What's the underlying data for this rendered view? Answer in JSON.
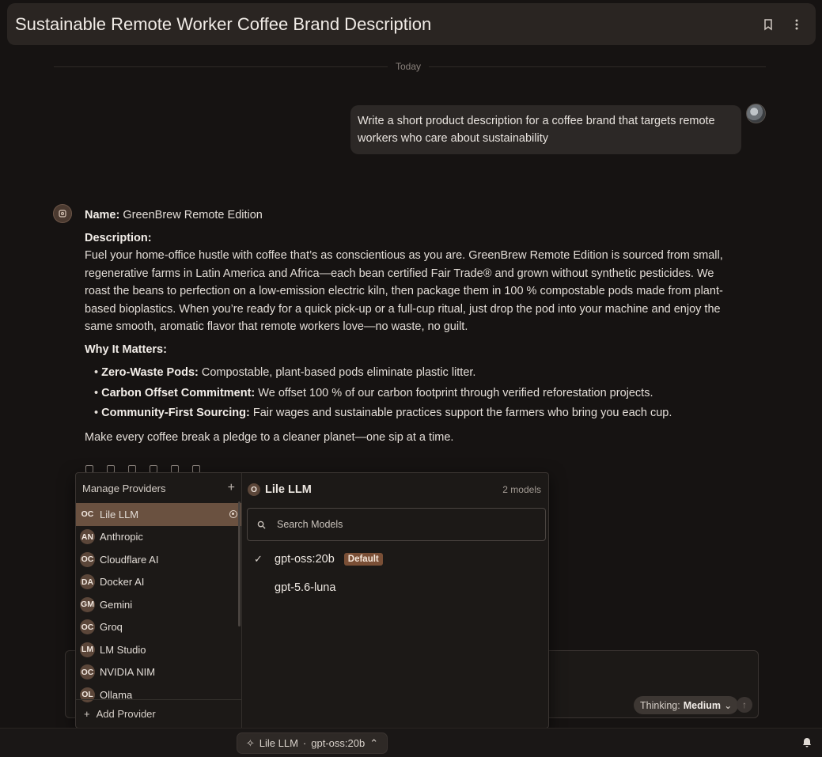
{
  "header": {
    "title": "Sustainable Remote Worker Coffee Brand Description",
    "bookmark_icon": "bookmark-icon",
    "more_icon": "more-vertical-icon"
  },
  "chat": {
    "day_label": "Today",
    "user_message": "Write a short product description for a coffee brand that targets remote workers who care about sustainability",
    "assistant": {
      "name_label": "Name:",
      "name_value": "GreenBrew Remote Edition",
      "description_label": "Description:",
      "description_text": "Fuel your home-office hustle with coffee that’s as conscientious as you are. GreenBrew Remote Edition is sourced from small, regenerative farms in Latin America and Africa—each bean certified Fair Trade® and grown without synthetic pesticides. We roast the beans to perfection on a low-emission electric kiln, then package them in 100 % compostable pods made from plant-based bioplastics. When you’re ready for a quick pick-up or a full-cup ritual, just drop the pod into your machine and enjoy the same smooth, aromatic flavor that remote workers love—no waste, no guilt.",
      "why_label": "Why It Matters:",
      "bullets": [
        {
          "title": "Zero-Waste Pods:",
          "text": "Compostable, plant-based pods eliminate plastic litter."
        },
        {
          "title": "Carbon Offset Commitment:",
          "text": "We offset 100 % of our carbon footprint through verified reforestation projects."
        },
        {
          "title": "Community-First Sourcing:",
          "text": "Fair wages and sustainable practices support the farmers who bring you each cup."
        }
      ],
      "closing": "Make every coffee break a pledge to a cleaner planet—one sip at a time."
    }
  },
  "providers_panel": {
    "title": "Manage Providers",
    "add_label": "+",
    "providers": [
      {
        "badge": "OC",
        "name": "Lile LLM",
        "selected": true
      },
      {
        "badge": "AN",
        "name": "Anthropic"
      },
      {
        "badge": "OC",
        "name": "Cloudflare AI"
      },
      {
        "badge": "DA",
        "name": "Docker AI"
      },
      {
        "badge": "GM",
        "name": "Gemini"
      },
      {
        "badge": "OC",
        "name": "Groq"
      },
      {
        "badge": "LM",
        "name": "LM Studio"
      },
      {
        "badge": "OC",
        "name": "NVIDIA NIM"
      },
      {
        "badge": "OL",
        "name": "Ollama"
      }
    ],
    "add_provider": "Add Provider"
  },
  "models_panel": {
    "badge": "O",
    "provider_name": "Lile LLM",
    "count": "2 models",
    "search_placeholder": "Search Models",
    "models": [
      {
        "name": "gpt-oss:20b",
        "tag": "Default",
        "selected": true
      },
      {
        "name": "gpt-5.6-luna"
      }
    ]
  },
  "composer": {
    "thinking_label": "Thinking:",
    "thinking_value": "Medium"
  },
  "footer": {
    "provider": "Lile LLM",
    "separator": "·",
    "model": "gpt-oss:20b"
  },
  "colors": {
    "background": "#161312",
    "accent": "#6a5140",
    "default_tag": "#7a4f36"
  }
}
